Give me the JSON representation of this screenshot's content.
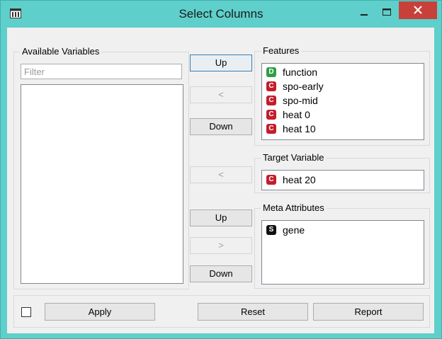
{
  "window": {
    "title": "Select Columns"
  },
  "available": {
    "title": "Available Variables",
    "filter_placeholder": "Filter"
  },
  "features": {
    "title": "Features",
    "items": [
      {
        "type": "D",
        "name": "function"
      },
      {
        "type": "C",
        "name": "spo-early"
      },
      {
        "type": "C",
        "name": "spo-mid"
      },
      {
        "type": "C",
        "name": "heat 0"
      },
      {
        "type": "C",
        "name": "heat 10"
      }
    ]
  },
  "target": {
    "title": "Target Variable",
    "items": [
      {
        "type": "C",
        "name": "heat 20"
      }
    ]
  },
  "meta": {
    "title": "Meta Attributes",
    "items": [
      {
        "type": "S",
        "name": "gene"
      }
    ]
  },
  "move_buttons": {
    "features_up": "Up",
    "features_move_left": "<",
    "features_down": "Down",
    "target_move_left": "<",
    "meta_up": "Up",
    "meta_move_right": ">",
    "meta_down": "Down"
  },
  "bottom": {
    "apply": "Apply",
    "reset": "Reset",
    "report": "Report"
  },
  "colors": {
    "window_frame": "#5fcfcb",
    "close_button": "#c7413a",
    "continuous_badge": "#c41d2b",
    "discrete_badge": "#2f9e44",
    "string_badge": "#111111"
  }
}
